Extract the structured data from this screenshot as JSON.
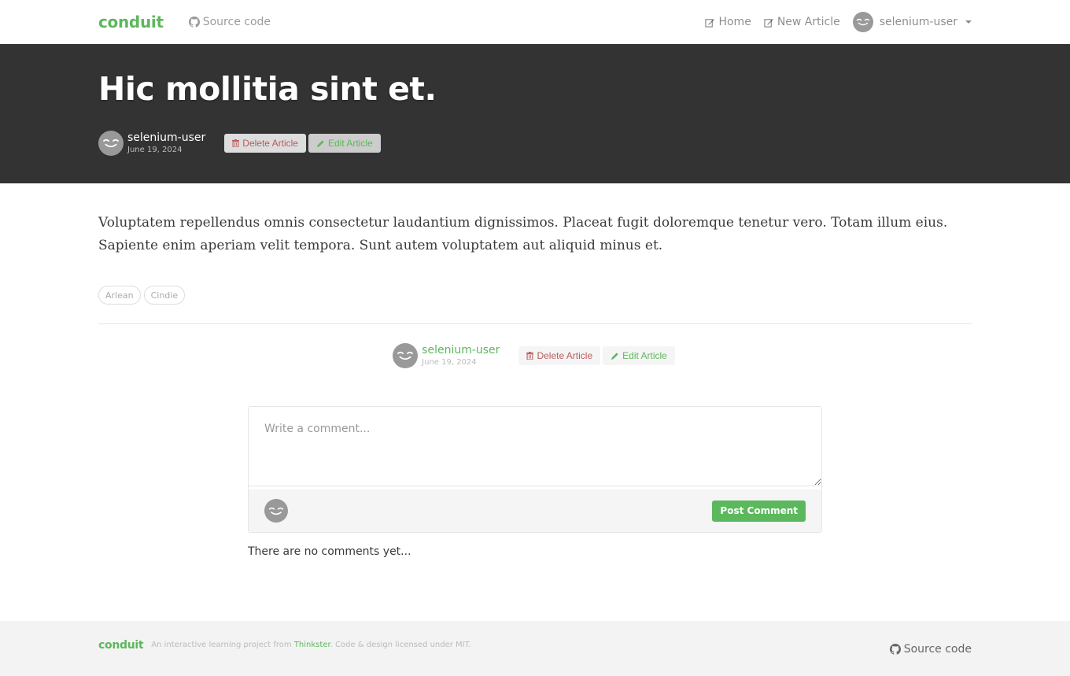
{
  "nav": {
    "brand": "conduit",
    "source_code": "Source code",
    "home": "Home",
    "new_article": "New Article",
    "username": "selenium-user"
  },
  "article": {
    "title": "Hic mollitia sint et.",
    "author": "selenium-user",
    "date": "June 19, 2024",
    "delete_label": "Delete Article",
    "edit_label": "Edit Article",
    "body": "Voluptatem repellendus omnis consectetur laudantium dignissimos. Placeat fugit doloremque tenetur vero. Totam illum eius. Sapiente enim aperiam velit tempora. Sunt autem voluptatem aut aliquid minus et.",
    "tags": [
      "Arlean",
      "Cindie"
    ]
  },
  "comments": {
    "placeholder": "Write a comment...",
    "post_label": "Post Comment",
    "empty_text": "There are no comments yet..."
  },
  "footer": {
    "brand": "conduit",
    "attribution_prefix": "An interactive learning project from",
    "attribution_link": "Thinkster",
    "attribution_suffix": ". Code & design licensed under MIT.",
    "source_code": "Source code"
  }
}
